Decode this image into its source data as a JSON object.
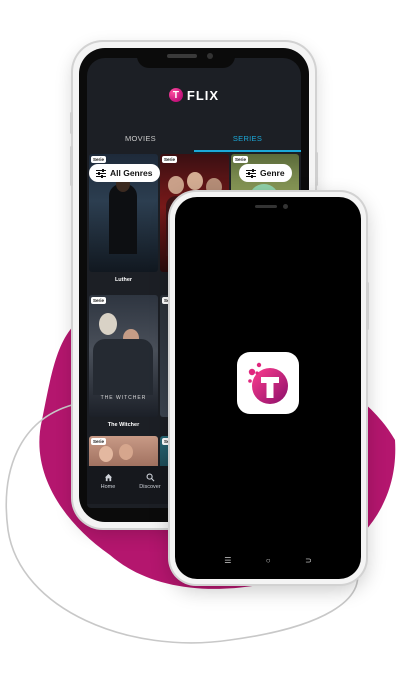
{
  "app": {
    "name": "FLIX",
    "logo_letter": "T",
    "brand_color": "#c2127a",
    "accent_color": "#1ba9d9"
  },
  "tabs": [
    {
      "label": "MOVIES",
      "active": false
    },
    {
      "label": "SERIES",
      "active": true
    }
  ],
  "filters": {
    "all_genres": "All Genres",
    "genre": "Genre"
  },
  "posters": [
    {
      "badge": "Serie",
      "title": "Luther"
    },
    {
      "badge": "Serie",
      "title": ""
    },
    {
      "badge": "Serie",
      "title": ""
    },
    {
      "badge": "Serie",
      "title": "The Witcher"
    },
    {
      "badge": "Serie",
      "title": ""
    },
    {
      "badge": "Serie",
      "title": ""
    },
    {
      "badge": "Serie",
      "title": ""
    }
  ],
  "bottom_nav": [
    {
      "label": "Home",
      "icon": "home-icon"
    },
    {
      "label": "Discover",
      "icon": "search-icon"
    }
  ],
  "splash": {
    "icon": "flix-logo-icon"
  },
  "system_nav": {
    "recent": "☰",
    "home": "○",
    "back": "⊃"
  }
}
